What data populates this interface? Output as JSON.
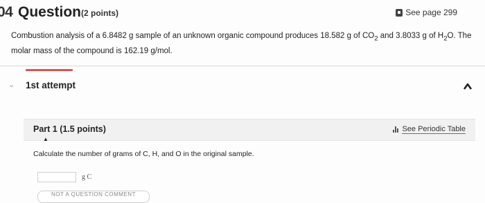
{
  "question": {
    "number_fragment": "04",
    "title": "Question",
    "points": "(2 points)",
    "see_page": "See page 299",
    "text_a": "Combustion analysis of a  6.8482  g sample of an unknown organic compound produces  18.582  g of CO",
    "text_b": " and  3.8033  g of H",
    "text_c": "O. The molar mass of the compound is 162.19  g/mol."
  },
  "attempt": {
    "label": "1st attempt"
  },
  "part": {
    "label": "Part 1   (1.5 points)",
    "periodic_table": "See Periodic Table",
    "instruction": "Calculate the number of grams of C, H, and O in the original sample.",
    "unit": "g C",
    "answer_value": "",
    "hint_label": "NOT A QUESTION COMMENT"
  },
  "colors": {
    "accent_red": "#d9534f",
    "part_bg": "#f1f1f1"
  }
}
